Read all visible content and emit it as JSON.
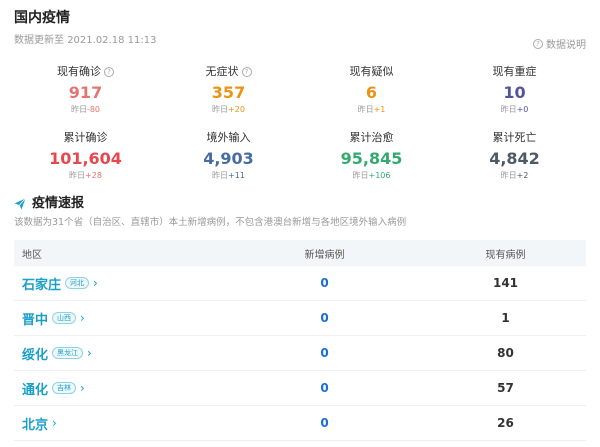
{
  "header": {
    "title": "国内疫情",
    "update_prefix": "数据更新至",
    "update_time": "2021.02.18 11:13",
    "explain_label": "数据说明"
  },
  "stats": {
    "delta_prefix": "昨日",
    "row1": [
      {
        "label": "现有确诊",
        "value": "917",
        "delta": "-80",
        "has_help": true
      },
      {
        "label": "无症状",
        "value": "357",
        "delta": "+20",
        "has_help": true
      },
      {
        "label": "现有疑似",
        "value": "6",
        "delta": "+1",
        "has_help": false
      },
      {
        "label": "现有重症",
        "value": "10",
        "delta": "+0",
        "has_help": false
      }
    ],
    "row2": [
      {
        "label": "累计确诊",
        "value": "101,604",
        "delta": "+28"
      },
      {
        "label": "境外输入",
        "value": "4,903",
        "delta": "+11"
      },
      {
        "label": "累计治愈",
        "value": "95,845",
        "delta": "+106"
      },
      {
        "label": "累计死亡",
        "value": "4,842",
        "delta": "+2"
      }
    ],
    "colors": {
      "confirmed": "#e57471",
      "asymptomatic": "#ec9217",
      "suspected": "#ec9217",
      "severe": "#545499",
      "total_confirmed": "#e5484d",
      "imported": "#476da0",
      "cured": "#34aa70",
      "death": "#4e5a65"
    }
  },
  "section": {
    "title": "疫情速报",
    "description": "该数据为31个省（自治区、直辖市）本土新增病例，不包含港澳台新增与各地区境外输入病例"
  },
  "table": {
    "headers": {
      "region": "地区",
      "new": "新增病例",
      "current": "现有病例"
    },
    "rows": [
      {
        "city": "石家庄",
        "province": "河北",
        "new": "0",
        "current": "141"
      },
      {
        "city": "晋中",
        "province": "山西",
        "new": "0",
        "current": "1"
      },
      {
        "city": "绥化",
        "province": "黑龙江",
        "new": "0",
        "current": "80"
      },
      {
        "city": "通化",
        "province": "吉林",
        "new": "0",
        "current": "57"
      },
      {
        "city": "北京",
        "province": "",
        "new": "0",
        "current": "26"
      }
    ]
  }
}
